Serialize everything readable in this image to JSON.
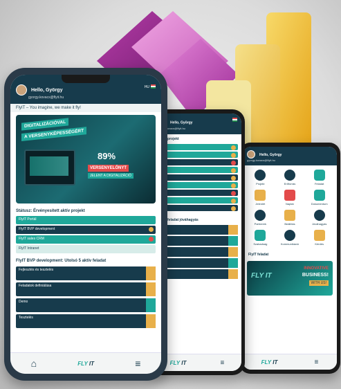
{
  "phone1": {
    "greeting": "Hello, György",
    "email": "gyorgy.kovacs@flyit.hu",
    "lang": "HU",
    "tagline": "FlyIT – You imagine, we make it fly!",
    "banner": {
      "line1": "DIGITALIZÁCIÓVAL",
      "line2": "A VERSENYKÉPESSÉGÉRT",
      "percent": "89%",
      "line3": "VERSENYELŐNYT",
      "line4": "JELENT A DIGITALIZÁCIÓ"
    },
    "section1": "Státusz: Érvényesített aktív projekt",
    "rows": [
      "FlyIT Portál",
      "FlyIT BVP development",
      "FlyIT sales CRM",
      "FlyIT Intranet"
    ],
    "section2": "FlyIT BVP development: Utolsó 5 aktív feladat",
    "tasks": [
      "Fejlesztés és tesztelés",
      "Feladatok definiálása",
      "Demo",
      "Tesztelés"
    ],
    "nav": {
      "home_icon": "home-icon",
      "menu_icon": "hamburger-icon"
    }
  },
  "phone2": {
    "greeting": "Hello, György",
    "email": "gyorgy.kovacs@flyit.hu",
    "section1": "FlyIT projekt",
    "section2": "FlyIT feladat jóváhagyás",
    "logo1": "FLY",
    "logo2": "IT"
  },
  "phone3": {
    "greeting": "Hello, György",
    "email": "gyorgy.kovacs@flyit.hu",
    "grid": [
      "Projekt",
      "Erőforrás",
      "Feladat",
      "Jelenlét",
      "Naptár",
      "Dokumentum",
      "Partnerek",
      "Beállítás",
      "Jóváhagyás",
      "Szabadság",
      "Kommunikáció",
      "Kérdés"
    ],
    "tasks_label": "FlyIT feladat",
    "biz": {
      "t1": "INNOVATIVE",
      "t2": "BUSINESS!",
      "t3": "WITH US!",
      "logo": "FLY IT"
    },
    "logo1": "FLY",
    "logo2": "IT"
  },
  "colors": {
    "navy": "#173b4c",
    "teal": "#1fa89a",
    "accent_orange": "#e8b04a",
    "accent_red": "#e34b4b"
  }
}
